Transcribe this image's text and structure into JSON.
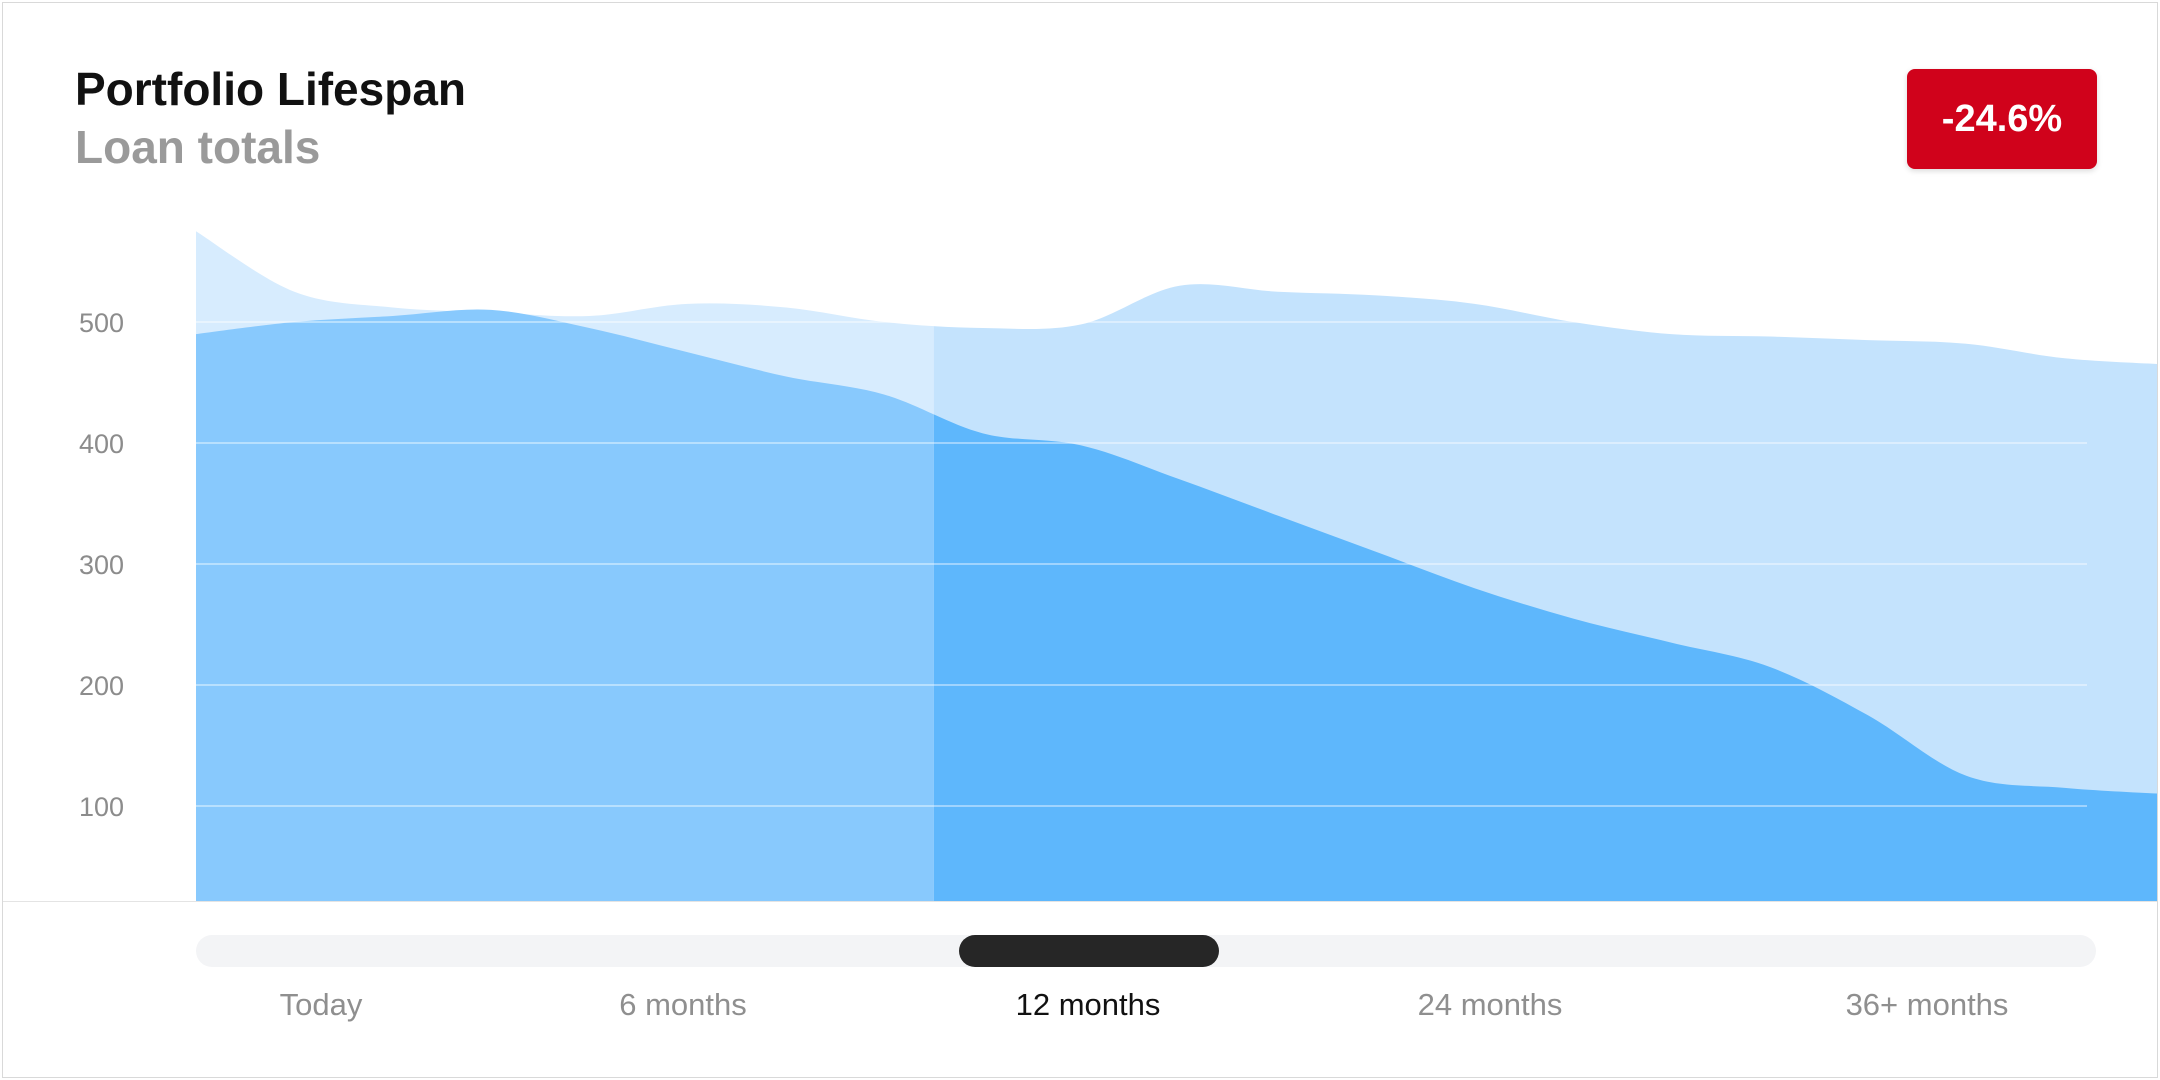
{
  "header": {
    "title": "Portfolio Lifespan",
    "subtitle": "Loan totals",
    "change_badge": "-24.6%",
    "change_color": "#d0021b"
  },
  "slider": {
    "labels": [
      "Today",
      "6 months",
      "12 months",
      "24 months",
      "36+ months"
    ],
    "selected_label": "12 months"
  },
  "chart_data": {
    "type": "area",
    "title": "Portfolio Lifespan",
    "subtitle": "Loan totals",
    "ylim": [
      20,
      560
    ],
    "yticks": [
      100,
      200,
      300,
      400,
      500
    ],
    "grid": true,
    "x": [
      0,
      1,
      2,
      3,
      4,
      5,
      6,
      7,
      8,
      9,
      10,
      11,
      12,
      13,
      14,
      15,
      16,
      17,
      18,
      19,
      20
    ],
    "series": [
      {
        "color": "#c4e3fd",
        "values": [
          575,
          525,
          512,
          508,
          505,
          515,
          512,
          500,
          495,
          498,
          530,
          525,
          522,
          515,
          500,
          490,
          488,
          485,
          482,
          470,
          465
        ]
      },
      {
        "color": "#5eb7fc",
        "values": [
          490,
          500,
          505,
          510,
          495,
          475,
          455,
          440,
          408,
          398,
          370,
          340,
          310,
          280,
          255,
          235,
          215,
          175,
          125,
          115,
          110
        ]
      }
    ],
    "highlight_until_index": 7.5,
    "highlight_colors": {
      "back": "#d7ecfe",
      "front": "#88c9fd"
    }
  }
}
